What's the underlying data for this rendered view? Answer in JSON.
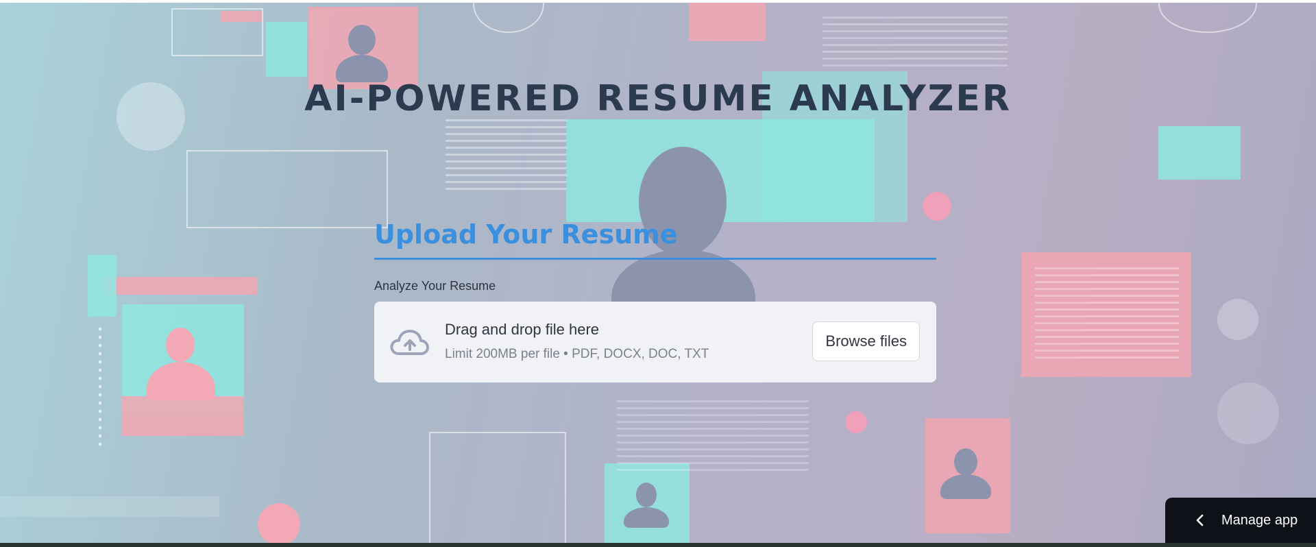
{
  "header": {
    "title": "AI-POWERED RESUME ANALYZER"
  },
  "upload_section": {
    "heading": "Upload Your Resume",
    "uploader_label": "Analyze Your Resume",
    "dropzone": {
      "primary_text": "Drag and drop file here",
      "secondary_text": "Limit 200MB per file • PDF, DOCX, DOC, TXT",
      "icon": "cloud-upload-icon"
    },
    "browse_button_label": "Browse files"
  },
  "footer": {
    "manage_app_label": "Manage app",
    "manage_app_icon": "chevron-left-icon"
  },
  "colors": {
    "heading_accent": "#3a90de",
    "title_text": "#2c3a4f",
    "dropzone_bg": "#f0f2f6",
    "manage_app_bg": "#0e1117"
  }
}
